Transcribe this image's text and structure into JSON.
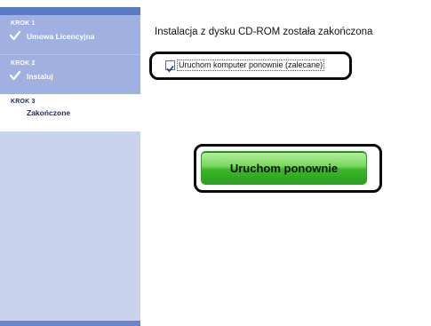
{
  "sidebar": {
    "steps": [
      {
        "num": "KROK 1",
        "label": "Umowa Licencyjna",
        "completed": true
      },
      {
        "num": "KROK 2",
        "label": "Instaluj",
        "completed": true
      },
      {
        "num": "KROK 3",
        "label": "Zakończone",
        "completed": false,
        "active": true
      }
    ]
  },
  "main": {
    "title": "Instalacja z dysku CD-ROM została zakończona",
    "restart_checkbox": {
      "label": "Uruchom komputer ponownie (zalecane)",
      "checked": true
    },
    "restart_button_label": "Uruchom ponownie"
  },
  "colors": {
    "sidebar_bg": "#c9d3ee",
    "step_done_bg": "#9fb0e1",
    "sidebar_accent": "#5c79c4",
    "button_green": "#3cb52a"
  }
}
